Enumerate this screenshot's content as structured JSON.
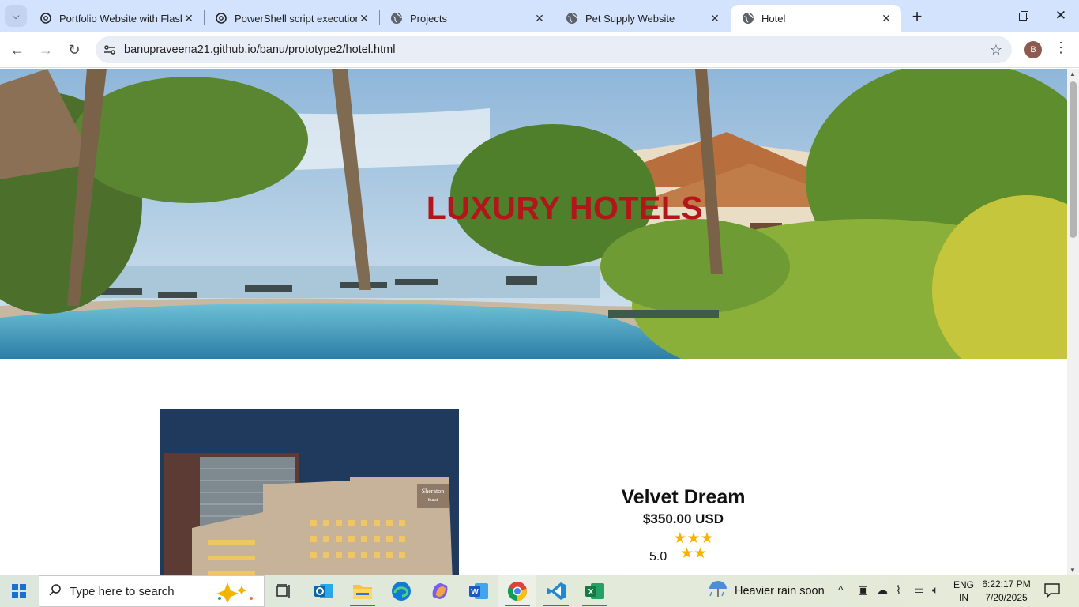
{
  "browser": {
    "tabs": [
      {
        "title": "Portfolio Website with Flask",
        "icon": "chatgpt-icon",
        "active": false
      },
      {
        "title": "PowerShell script execution f",
        "icon": "chatgpt-icon",
        "active": false
      },
      {
        "title": "Projects",
        "icon": "globe-icon",
        "active": false
      },
      {
        "title": "Pet Supply Website",
        "icon": "globe-icon",
        "active": false
      },
      {
        "title": "Hotel",
        "icon": "globe-icon",
        "active": true
      }
    ],
    "url": "banupraveena21.github.io/banu/prototype2/hotel.html",
    "profile_initial": "B"
  },
  "page": {
    "hero_title": "LUXURY HOTELS",
    "hotel": {
      "name": "Velvet Dream",
      "price": "$350.00 USD",
      "stars": 5,
      "rating": "5.0",
      "sign_text_1": "Sheraton",
      "sign_text_2": "Surat"
    }
  },
  "taskbar": {
    "search_placeholder": "Type here to search",
    "weather": "Heavier rain soon",
    "lang_line1": "ENG",
    "lang_line2": "IN",
    "time": "6:22:17 PM",
    "date": "7/20/2025"
  },
  "colors": {
    "hero_title": "#b3161a",
    "star": "#f5b301",
    "tabbar": "#d3e3fd"
  }
}
